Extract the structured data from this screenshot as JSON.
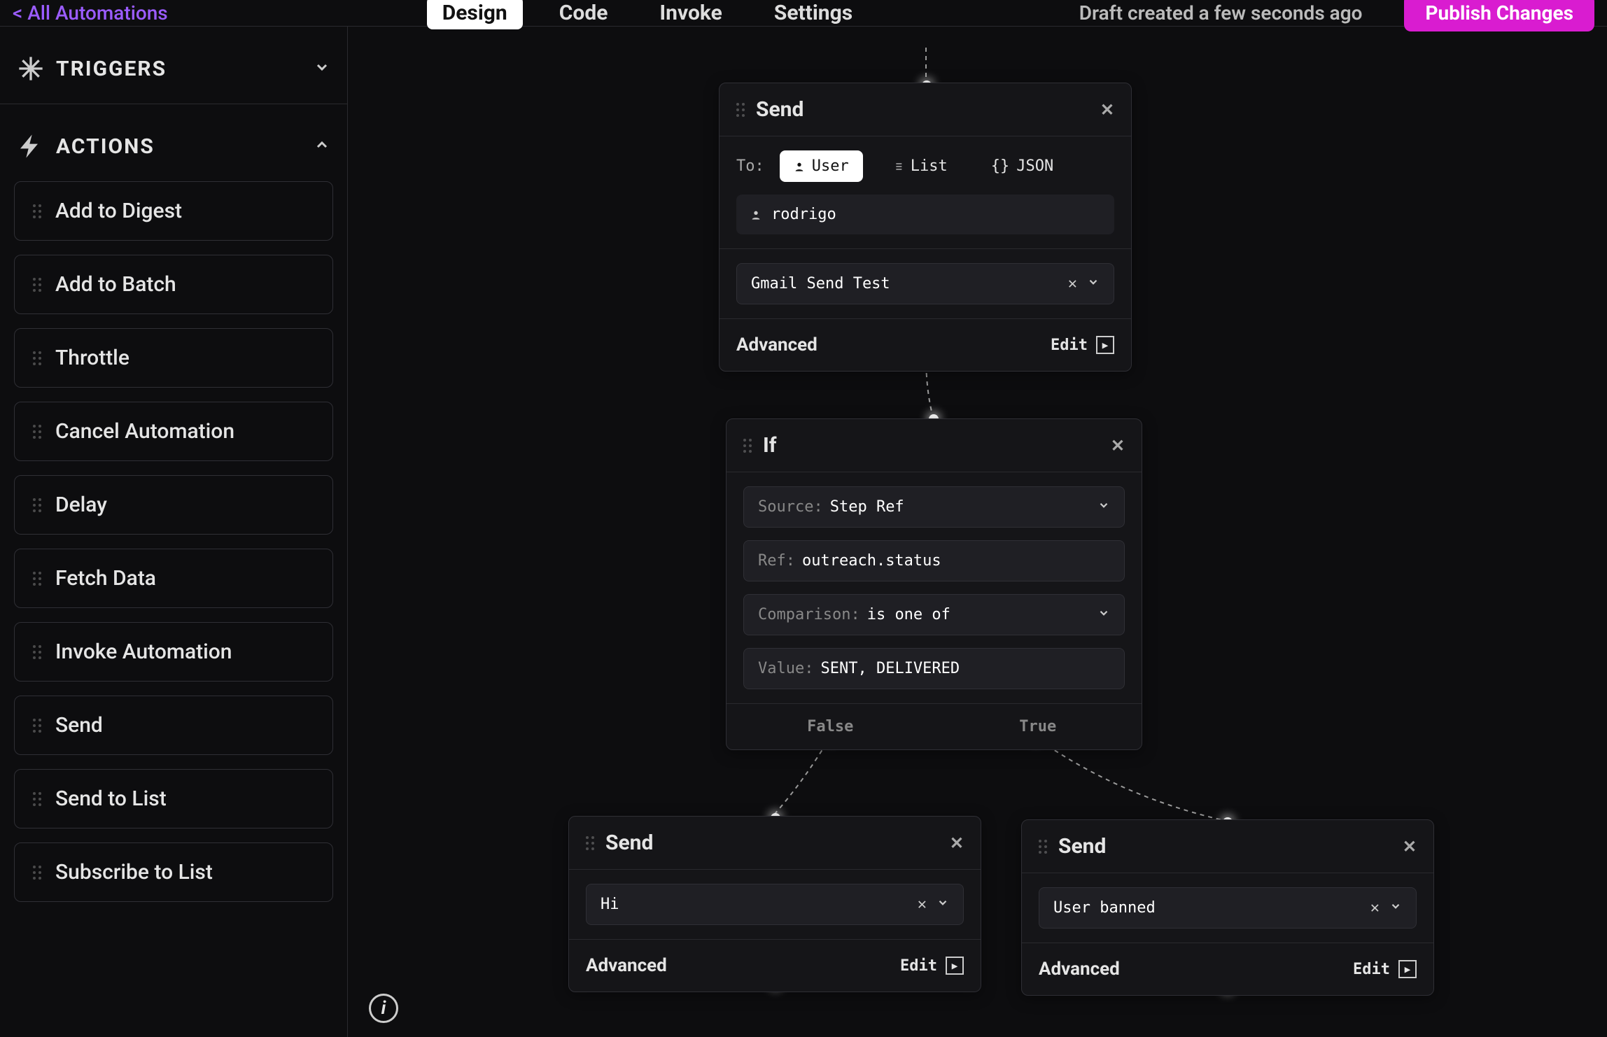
{
  "nav": {
    "back_label": "All Automations",
    "tabs": [
      {
        "label": "Design",
        "active": true
      },
      {
        "label": "Code",
        "active": false
      },
      {
        "label": "Invoke",
        "active": false
      },
      {
        "label": "Settings",
        "active": false
      }
    ],
    "status": "Draft created a few seconds ago",
    "publish_label": "Publish Changes"
  },
  "sidebar": {
    "triggers_title": "TRIGGERS",
    "actions_title": "ACTIONS",
    "actions": [
      "Add to Digest",
      "Add to Batch",
      "Throttle",
      "Cancel Automation",
      "Delay",
      "Fetch Data",
      "Invoke Automation",
      "Send",
      "Send to List",
      "Subscribe to List"
    ]
  },
  "nodes": {
    "send1": {
      "title": "Send",
      "to_label": "To:",
      "to_options": [
        {
          "icon": "user",
          "label": "User",
          "active": true
        },
        {
          "icon": "list",
          "label": "List",
          "active": false
        },
        {
          "icon": "json",
          "label": "JSON",
          "active": false
        }
      ],
      "to_value": "rodrigo",
      "template": "Gmail Send Test",
      "advanced_label": "Advanced",
      "edit_label": "Edit"
    },
    "if1": {
      "title": "If",
      "source_label": "Source:",
      "source_value": "Step Ref",
      "ref_label": "Ref:",
      "ref_value": "outreach.status",
      "comparison_label": "Comparison:",
      "comparison_value": "is one of",
      "value_label": "Value:",
      "value_value": "SENT, DELIVERED",
      "false_label": "False",
      "true_label": "True"
    },
    "send_false": {
      "title": "Send",
      "template": "Hi",
      "advanced_label": "Advanced",
      "edit_label": "Edit"
    },
    "send_true": {
      "title": "Send",
      "template": "User banned",
      "advanced_label": "Advanced",
      "edit_label": "Edit"
    }
  }
}
